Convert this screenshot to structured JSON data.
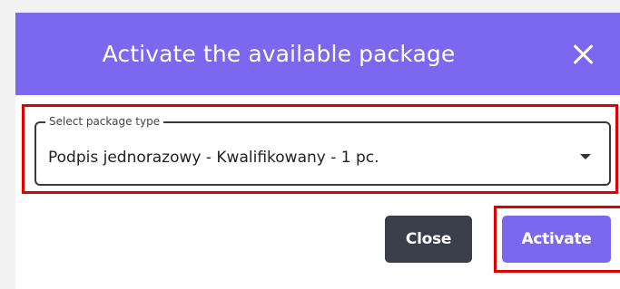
{
  "dialog": {
    "title": "Activate the available package",
    "close_icon": "close-icon",
    "header_color": "#7b68ee"
  },
  "package_select": {
    "label": "Select package type",
    "selected_value": "Podpis jednorazowy - Kwalifikowany - 1 pc.",
    "caret_icon": "caret-down-icon"
  },
  "actions": {
    "close_label": "Close",
    "activate_label": "Activate"
  },
  "colors": {
    "accent": "#7b68ee",
    "dark_button": "#3a3f4b",
    "highlight": "#e00000"
  }
}
